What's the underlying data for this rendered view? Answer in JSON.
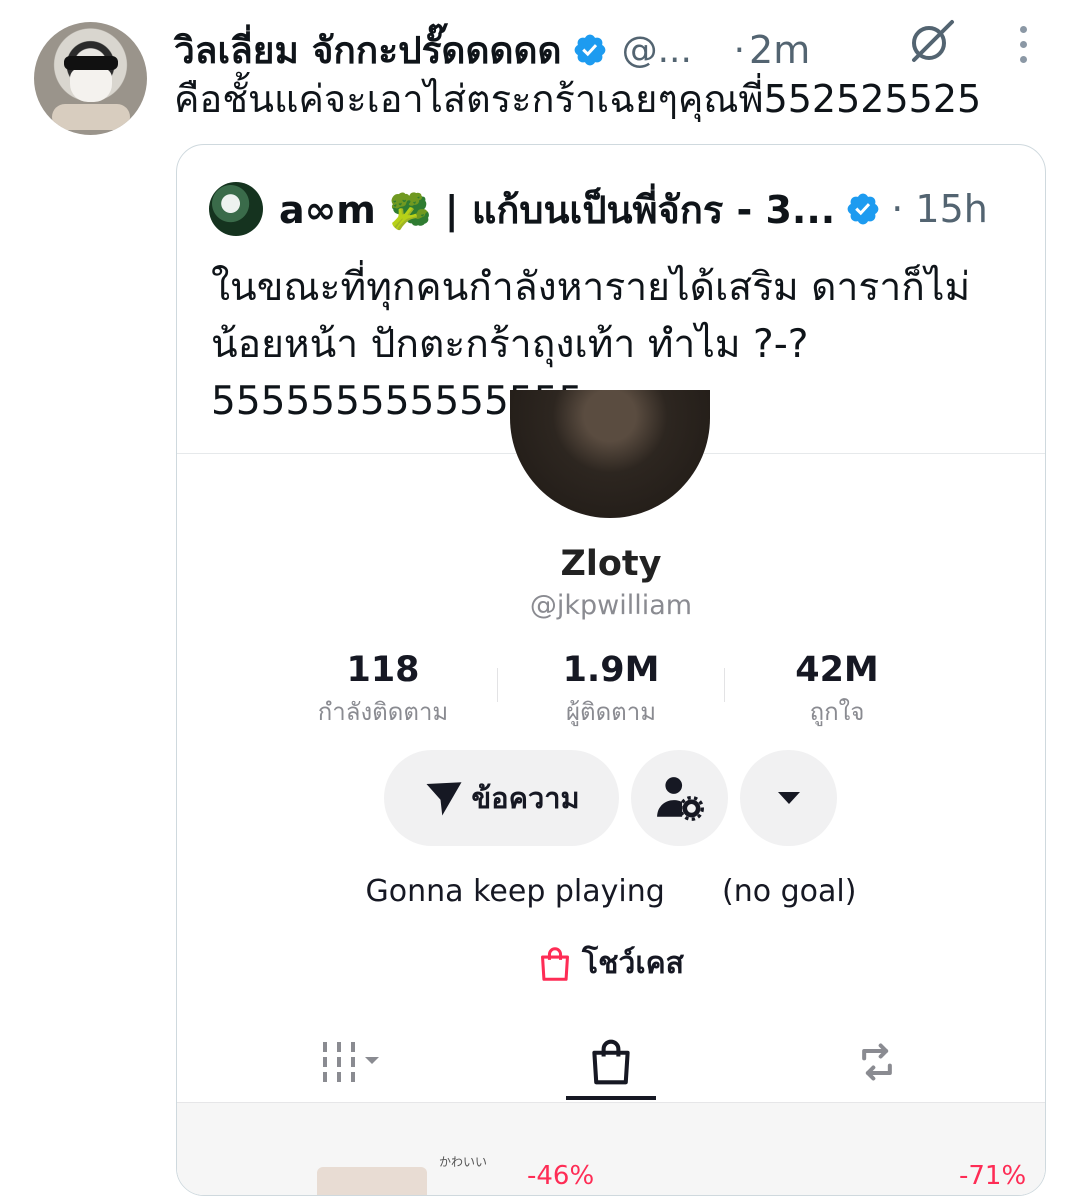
{
  "tweet": {
    "author_name": "วิลเลี่ยม จักกะปรั๊ดดดดด",
    "handle": "@...",
    "dot": "·",
    "time": "2m",
    "text": "คือชั้นแค่จะเอาไส่ตระกร้าเฉยๆคุณพี่552525525"
  },
  "quote": {
    "author_name": "a∞m",
    "author_emoji": "🥦",
    "author_suffix": " | แก้บนเป็นพี่จักร - 3...",
    "dot": "·",
    "time": "15h",
    "text_lines": [
      "ในขณะที่ทุกคนกำลังหารายได้เสริม ดาราก็ไม่",
      "น้อยหน้า ปักตะกร้าถุงเท้า ทำไม ?-?",
      "555555555555555"
    ]
  },
  "profile": {
    "name": "Zloty",
    "handle": "@jkpwilliam",
    "stats": [
      {
        "value": "118",
        "label": "กำลังติดตาม"
      },
      {
        "value": "1.9M",
        "label": "ผู้ติดตาม"
      },
      {
        "value": "42M",
        "label": "ถูกใจ"
      }
    ],
    "message_button": "ข้อความ",
    "bio": "Gonna keep playing      (no goal)",
    "showcase_label": "โชว์เคส",
    "discount_1": "-46%",
    "discount_2": "-71%",
    "kawaii": "かわいい"
  },
  "colors": {
    "verified": "#1d9bf0",
    "tiktok_red": "#fe2c55",
    "secondary_text": "#536471"
  },
  "icons": [
    "verified-badge-icon",
    "grok-icon",
    "more-vertical-icon",
    "send-icon",
    "person-settings-icon",
    "dropdown-icon",
    "shopping-bag-icon",
    "grid-icon",
    "repost-icon"
  ]
}
